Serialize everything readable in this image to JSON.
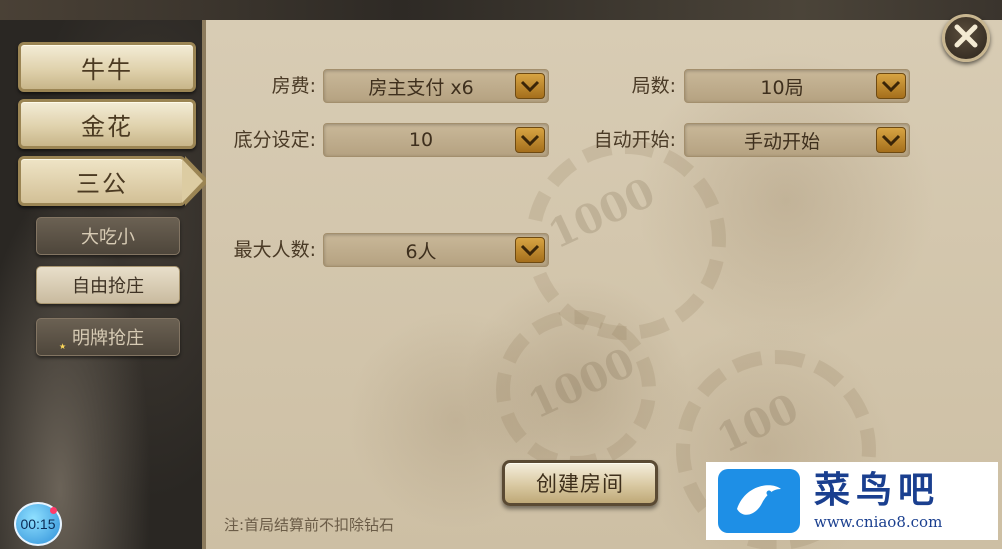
{
  "colors": {
    "accent_gold": "#c08a2c",
    "panel_bg": "#d4c7ad",
    "sidebar_bg": "#2a2723",
    "timer_blue": "#2e8fd8"
  },
  "sidebar": {
    "main_tabs": [
      {
        "label": "牛牛",
        "active": false
      },
      {
        "label": "金花",
        "active": false
      },
      {
        "label": "三公",
        "active": true
      }
    ],
    "sub_tabs": [
      {
        "label": "大吃小",
        "active": false
      },
      {
        "label": "自由抢庄",
        "active": true
      },
      {
        "label": "明牌抢庄",
        "active": false
      }
    ],
    "timer": "00:15"
  },
  "form": {
    "room_fee": {
      "label": "房费:",
      "value": "房主支付 x6"
    },
    "rounds": {
      "label": "局数:",
      "value": "10局"
    },
    "base_score": {
      "label": "底分设定:",
      "value": "10"
    },
    "auto_start": {
      "label": "自动开始:",
      "value": "手动开始"
    },
    "max_players": {
      "label": "最大人数:",
      "value": "6人"
    }
  },
  "actions": {
    "create_room": "创建房间"
  },
  "note": "注:首局结算前不扣除钻石",
  "icons": {
    "close": "close-icon",
    "dropdown": "chevron-down-icon",
    "logo": "bird-logo-icon"
  },
  "watermark": {
    "title": "菜鸟吧",
    "url": "www.cniao8.com"
  }
}
